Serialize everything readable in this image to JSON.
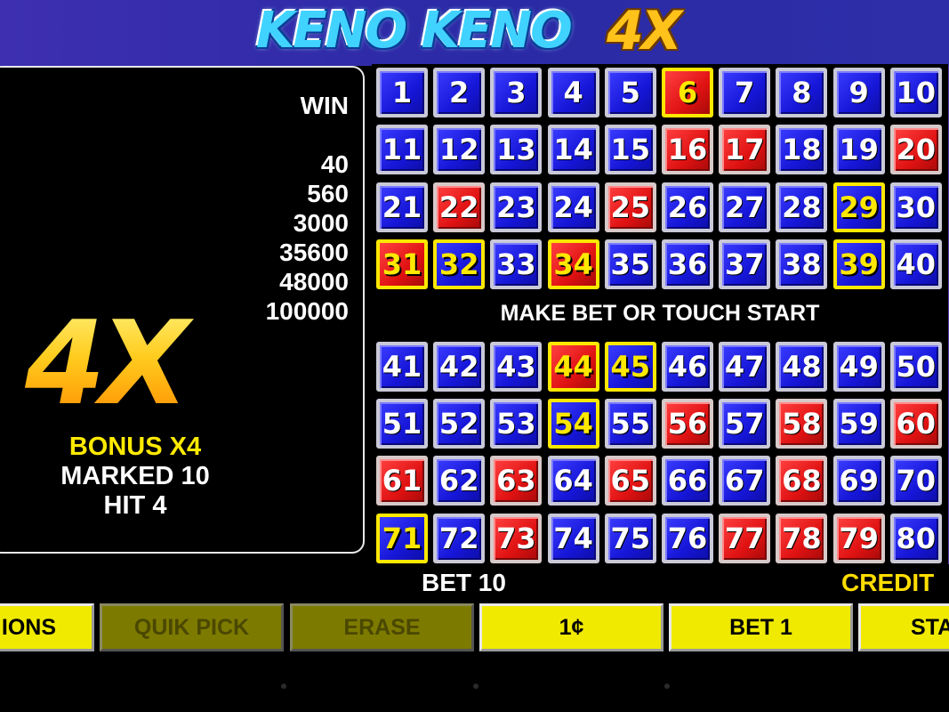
{
  "header": {
    "logo_text": "KENO KENO",
    "logo_multiplier": "4X"
  },
  "paytable": {
    "win_label": "WIN",
    "payouts": [
      "40",
      "560",
      "3000",
      "35600",
      "48000",
      "100000"
    ],
    "multiplier_art": "4X",
    "bonus_label": "BONUS X4",
    "marked_label": "MARKED 10",
    "hit_label": "HIT 4"
  },
  "board": {
    "message": "MAKE BET OR TOUCH START",
    "states_legend": {
      "blue": "not drawn",
      "red": "drawn",
      "sel-blue": "marked, not drawn",
      "sel-red": "marked and drawn (hit)"
    },
    "cells": [
      {
        "n": "1",
        "s": "blue"
      },
      {
        "n": "2",
        "s": "blue"
      },
      {
        "n": "3",
        "s": "blue"
      },
      {
        "n": "4",
        "s": "blue"
      },
      {
        "n": "5",
        "s": "blue"
      },
      {
        "n": "6",
        "s": "sel-red"
      },
      {
        "n": "7",
        "s": "blue"
      },
      {
        "n": "8",
        "s": "blue"
      },
      {
        "n": "9",
        "s": "blue"
      },
      {
        "n": "10",
        "s": "blue"
      },
      {
        "n": "11",
        "s": "blue"
      },
      {
        "n": "12",
        "s": "blue"
      },
      {
        "n": "13",
        "s": "blue"
      },
      {
        "n": "14",
        "s": "blue"
      },
      {
        "n": "15",
        "s": "blue"
      },
      {
        "n": "16",
        "s": "red"
      },
      {
        "n": "17",
        "s": "red"
      },
      {
        "n": "18",
        "s": "blue"
      },
      {
        "n": "19",
        "s": "blue"
      },
      {
        "n": "20",
        "s": "red"
      },
      {
        "n": "21",
        "s": "blue"
      },
      {
        "n": "22",
        "s": "red"
      },
      {
        "n": "23",
        "s": "blue"
      },
      {
        "n": "24",
        "s": "blue"
      },
      {
        "n": "25",
        "s": "red"
      },
      {
        "n": "26",
        "s": "blue"
      },
      {
        "n": "27",
        "s": "blue"
      },
      {
        "n": "28",
        "s": "blue"
      },
      {
        "n": "29",
        "s": "sel-blue"
      },
      {
        "n": "30",
        "s": "blue"
      },
      {
        "n": "31",
        "s": "sel-red"
      },
      {
        "n": "32",
        "s": "sel-blue"
      },
      {
        "n": "33",
        "s": "blue"
      },
      {
        "n": "34",
        "s": "sel-red"
      },
      {
        "n": "35",
        "s": "blue"
      },
      {
        "n": "36",
        "s": "blue"
      },
      {
        "n": "37",
        "s": "blue"
      },
      {
        "n": "38",
        "s": "blue"
      },
      {
        "n": "39",
        "s": "sel-blue"
      },
      {
        "n": "40",
        "s": "blue"
      },
      {
        "n": "41",
        "s": "blue"
      },
      {
        "n": "42",
        "s": "blue"
      },
      {
        "n": "43",
        "s": "blue"
      },
      {
        "n": "44",
        "s": "sel-red"
      },
      {
        "n": "45",
        "s": "sel-blue"
      },
      {
        "n": "46",
        "s": "blue"
      },
      {
        "n": "47",
        "s": "blue"
      },
      {
        "n": "48",
        "s": "blue"
      },
      {
        "n": "49",
        "s": "blue"
      },
      {
        "n": "50",
        "s": "blue"
      },
      {
        "n": "51",
        "s": "blue"
      },
      {
        "n": "52",
        "s": "blue"
      },
      {
        "n": "53",
        "s": "blue"
      },
      {
        "n": "54",
        "s": "sel-blue"
      },
      {
        "n": "55",
        "s": "blue"
      },
      {
        "n": "56",
        "s": "red"
      },
      {
        "n": "57",
        "s": "blue"
      },
      {
        "n": "58",
        "s": "red"
      },
      {
        "n": "59",
        "s": "blue"
      },
      {
        "n": "60",
        "s": "red"
      },
      {
        "n": "61",
        "s": "red"
      },
      {
        "n": "62",
        "s": "blue"
      },
      {
        "n": "63",
        "s": "red"
      },
      {
        "n": "64",
        "s": "blue"
      },
      {
        "n": "65",
        "s": "red"
      },
      {
        "n": "66",
        "s": "blue"
      },
      {
        "n": "67",
        "s": "blue"
      },
      {
        "n": "68",
        "s": "red"
      },
      {
        "n": "69",
        "s": "blue"
      },
      {
        "n": "70",
        "s": "blue"
      },
      {
        "n": "71",
        "s": "sel-blue"
      },
      {
        "n": "72",
        "s": "blue"
      },
      {
        "n": "73",
        "s": "red"
      },
      {
        "n": "74",
        "s": "blue"
      },
      {
        "n": "75",
        "s": "blue"
      },
      {
        "n": "76",
        "s": "blue"
      },
      {
        "n": "77",
        "s": "red"
      },
      {
        "n": "78",
        "s": "red"
      },
      {
        "n": "79",
        "s": "red"
      },
      {
        "n": "80",
        "s": "blue"
      }
    ]
  },
  "status": {
    "bet": "BET 10",
    "credits": "CREDIT"
  },
  "buttons": {
    "options": "IONS",
    "quick_pick": "QUIK PICK",
    "erase": "ERASE",
    "denomination": "1¢",
    "bet_one": "BET 1",
    "start": "STA"
  },
  "colors": {
    "header_bg": "#2b2aa6",
    "tile_blue": "#1616d8",
    "tile_red": "#e01212",
    "highlight_yellow": "#ffe800",
    "button_yellow": "#f0ea00",
    "button_disabled": "#7d7a00"
  }
}
